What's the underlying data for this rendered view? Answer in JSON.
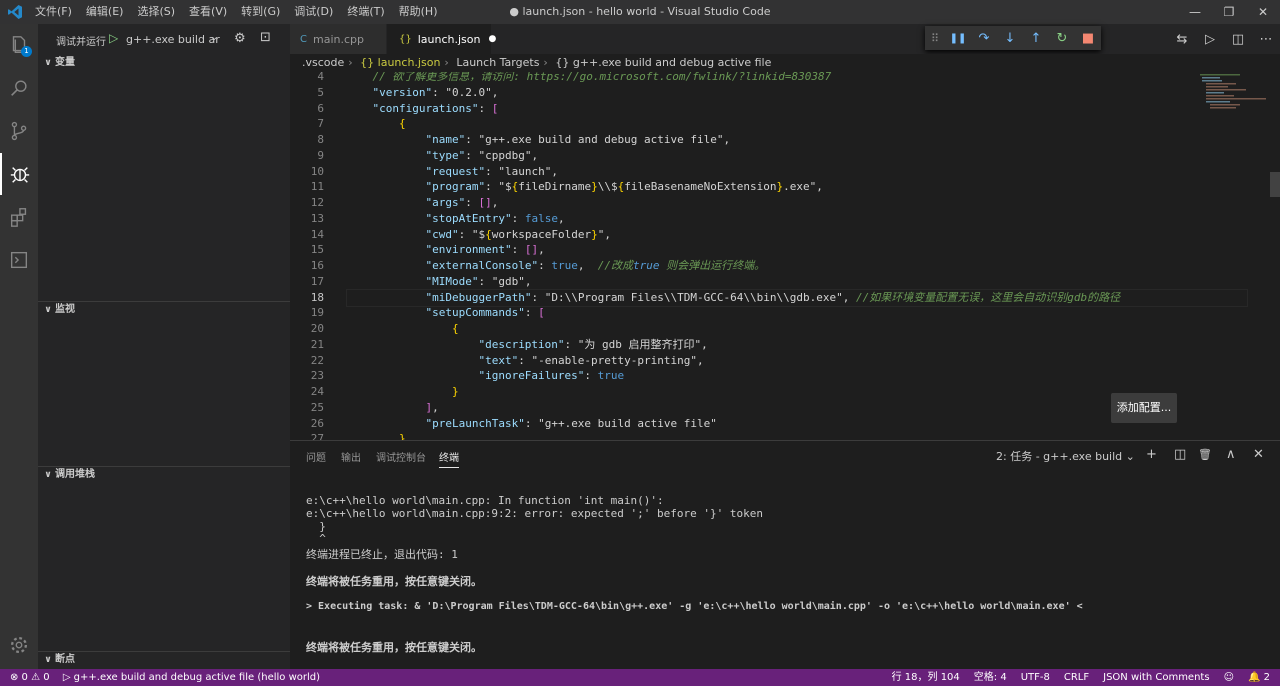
{
  "titlebar": {
    "menu": [
      "文件(F)",
      "编辑(E)",
      "选择(S)",
      "查看(V)",
      "转到(G)",
      "调试(D)",
      "终端(T)",
      "帮助(H)"
    ],
    "title": "● launch.json - hello world - Visual Studio Code",
    "buttons": {
      "minimize": "—",
      "restore": "❐",
      "close": "✕"
    }
  },
  "activity": {
    "explorer_badge": "1"
  },
  "sidebar": {
    "run_label": "调试并运行",
    "config_select": "g++.exe build ar",
    "sections": {
      "variables": "变量",
      "watch": "监视",
      "callstack": "调用堆栈",
      "breakpoints": "断点"
    }
  },
  "tabs": [
    {
      "label": "main.cpp",
      "icon": "C"
    },
    {
      "label": "launch.json",
      "icon": "{}",
      "modified": "●"
    }
  ],
  "debug_toolbar": {
    "grip": "⠿",
    "pause": "❚❚",
    "step_over": "↷",
    "step_into": "↓",
    "step_out": "↑",
    "restart": "↻",
    "stop": "■"
  },
  "editor_actions": {
    "compare": "⇆",
    "run": "▷",
    "split": "◫",
    "more": "⋯"
  },
  "breadcrumb": [
    ".vscode",
    "{} launch.json",
    "Launch Targets",
    "{} g++.exe build and debug active file"
  ],
  "editor": {
    "line_numbers": [
      "4",
      "5",
      "6",
      "7",
      "8",
      "9",
      "10",
      "11",
      "12",
      "13",
      "14",
      "15",
      "16",
      "17",
      "18",
      "19",
      "20",
      "21",
      "22",
      "23",
      "24",
      "25",
      "26",
      "27"
    ],
    "lines": [
      "    // 欲了解更多信息，请访问: https://go.microsoft.com/fwlink/?linkid=830387",
      "    \"version\": \"0.2.0\",",
      "    \"configurations\": [",
      "        {",
      "            \"name\": \"g++.exe build and debug active file\",",
      "            \"type\": \"cppdbg\",",
      "            \"request\": \"launch\",",
      "            \"program\": \"${fileDirname}\\\\${fileBasenameNoExtension}.exe\",",
      "            \"args\": [],",
      "            \"stopAtEntry\": false,",
      "            \"cwd\": \"${workspaceFolder}\",",
      "            \"environment\": [],",
      "            \"externalConsole\": true,  //改成true 则会弹出运行终端。",
      "            \"MIMode\": \"gdb\",",
      "            \"miDebuggerPath\": \"D:\\\\Program Files\\\\TDM-GCC-64\\\\bin\\\\gdb.exe\", //如果环境变量配置无误，这里会自动识别gdb的路径",
      "            \"setupCommands\": [",
      "                {",
      "                    \"description\": \"为 gdb 启用整齐打印\",",
      "                    \"text\": \"-enable-pretty-printing\",",
      "                    \"ignoreFailures\": true",
      "                }",
      "            ],",
      "            \"preLaunchTask\": \"g++.exe build active file\"",
      "        }"
    ],
    "add_config_button": "添加配置..."
  },
  "panel": {
    "tabs": [
      "问题",
      "输出",
      "调试控制台",
      "终端"
    ],
    "terminal_select": "2: 任务 - g++.exe build",
    "icons": {
      "add": "+",
      "split": "◫",
      "trash": "🗑",
      "maximize": "∧",
      "close": "✕"
    },
    "terminal_lines": [
      "e:\\c++\\hello world\\main.cpp: In function 'int main()':",
      "e:\\c++\\hello world\\main.cpp:9:2: error: expected ';' before '}' token",
      "  }",
      "  ^",
      "终端进程已终止，退出代码: 1",
      "终端将被任务重用，按任意键关闭。",
      "> Executing task: & 'D:\\Program Files\\TDM-GCC-64\\bin\\g++.exe' -g 'e:\\c++\\hello world\\main.cpp' -o 'e:\\c++\\hello world\\main.exe' <",
      "终端将被任务重用，按任意键关闭。"
    ]
  },
  "statusbar": {
    "errors": "⊗ 0",
    "warnings": "⚠ 0",
    "debug_target": "▷ g++.exe build and debug active file (hello world)",
    "position": "行 18，列 104",
    "spaces": "空格: 4",
    "encoding": "UTF-8",
    "eol": "CRLF",
    "language": "JSON with Comments",
    "notifications": "🔔 2"
  }
}
